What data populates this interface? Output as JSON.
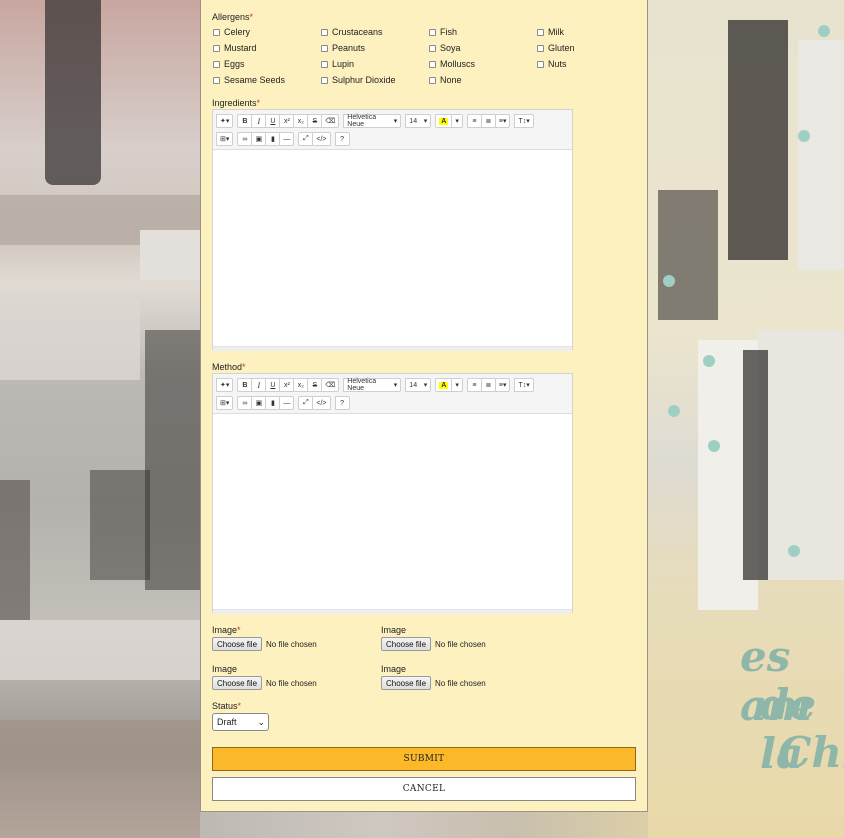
{
  "form": {
    "allergens": {
      "label": "Allergens",
      "required_mark": "*",
      "options": [
        {
          "label": "Celery",
          "checked": false
        },
        {
          "label": "Crustaceans",
          "checked": false
        },
        {
          "label": "Fish",
          "checked": false
        },
        {
          "label": "Milk",
          "checked": false
        },
        {
          "label": "Mustard",
          "checked": false
        },
        {
          "label": "Peanuts",
          "checked": false
        },
        {
          "label": "Soya",
          "checked": false
        },
        {
          "label": "Gluten",
          "checked": false
        },
        {
          "label": "Eggs",
          "checked": false
        },
        {
          "label": "Lupin",
          "checked": false
        },
        {
          "label": "Molluscs",
          "checked": false
        },
        {
          "label": "Nuts",
          "checked": false
        },
        {
          "label": "Sesame Seeds",
          "checked": false
        },
        {
          "label": "Sulphur Dioxide",
          "checked": false
        },
        {
          "label": "None",
          "checked": false
        }
      ]
    },
    "ingredients": {
      "label": "Ingredients",
      "required_mark": "*",
      "value": ""
    },
    "method": {
      "label": "Method",
      "required_mark": "*",
      "value": ""
    },
    "toolbar": {
      "font_name": "Helvetica Neue",
      "font_size": "14",
      "bold": "B",
      "italic": "I",
      "underline": "U",
      "superscript": "x²",
      "subscript": "x₂",
      "strikethrough": "S",
      "highlight": "A",
      "code": "</>",
      "help": "?",
      "highlight_color": "#ffff00"
    },
    "images": [
      {
        "label": "Image",
        "required_mark": "*",
        "button": "Choose file",
        "status": "No file chosen"
      },
      {
        "label": "Image",
        "required_mark": "",
        "button": "Choose file",
        "status": "No file chosen"
      },
      {
        "label": "Image",
        "required_mark": "",
        "button": "Choose file",
        "status": "No file chosen"
      },
      {
        "label": "Image",
        "required_mark": "",
        "button": "Choose file",
        "status": "No file chosen"
      }
    ],
    "status": {
      "label": "Status",
      "required_mark": "*",
      "selected": "Draft"
    },
    "submit_label": "SUBMIT",
    "cancel_label": "CANCEL"
  },
  "background": {
    "text_lines": [
      "es am",
      "de la",
      "Chi"
    ],
    "panel_color": "#fdf1c0",
    "submit_color": "#fbb829"
  }
}
